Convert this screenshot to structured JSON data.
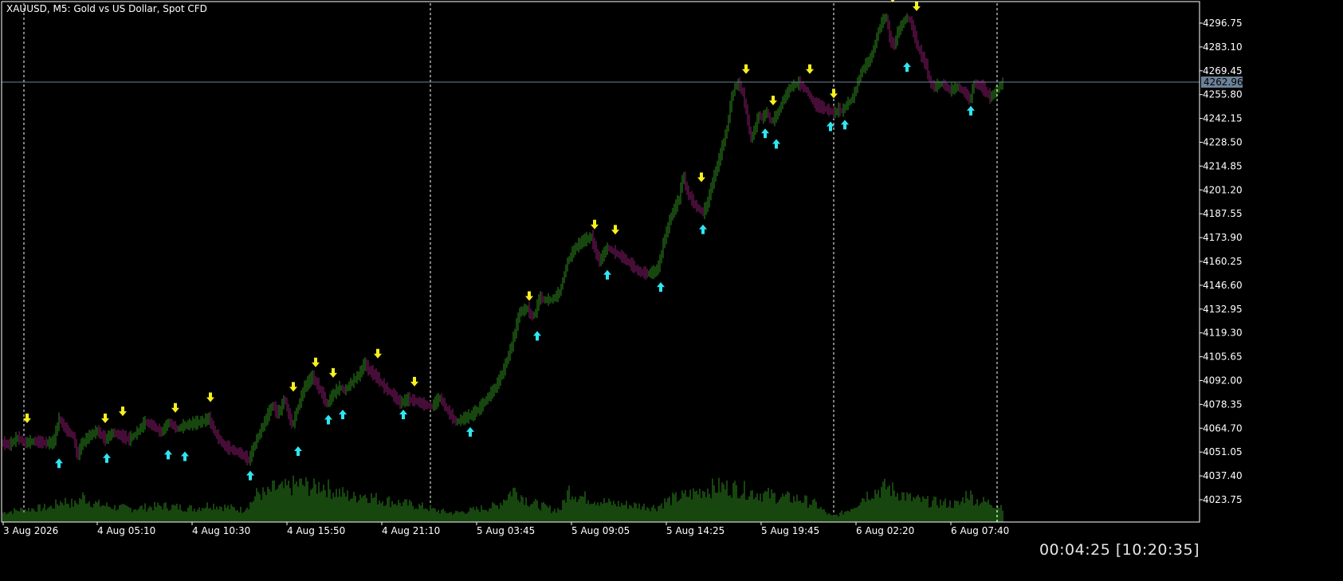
{
  "title": "XAUUSD, M5:  Gold vs US Dollar, Spot CFD",
  "timer": "00:04:25 [10:20:35]",
  "colors": {
    "background": "#000000",
    "bull": "#2e8b1e",
    "bear": "#8b1a6e",
    "volume": "#2e8b1e",
    "up_arrow": "#2fe6f0",
    "down_arrow": "#f5f01e",
    "price_line": "#6c8299",
    "price_label_bg": "#6c8299",
    "grid_separator": "#ffffff",
    "axis": "#ffffff"
  },
  "chart_data": {
    "type": "line",
    "symbol": "XAUUSD",
    "timeframe": "M5",
    "y_ticks": [
      "4296.75",
      "4283.10",
      "4269.45",
      "4255.80",
      "4242.15",
      "4228.50",
      "4214.85",
      "4201.20",
      "4187.55",
      "4173.90",
      "4160.25",
      "4146.60",
      "4132.95",
      "4119.30",
      "4105.65",
      "4092.00",
      "4078.35",
      "4064.70",
      "4051.05",
      "4037.40",
      "4023.75"
    ],
    "x_ticks": [
      "3 Aug 2026",
      "4 Aug 05:10",
      "4 Aug 10:30",
      "4 Aug 15:50",
      "4 Aug 21:10",
      "5 Aug 03:45",
      "5 Aug 09:05",
      "5 Aug 14:25",
      "5 Aug 19:45",
      "6 Aug 02:20",
      "6 Aug 07:40"
    ],
    "ylim": [
      4016,
      4307
    ],
    "current_price": "4262.96",
    "day_separators_index": [
      13,
      267,
      521
    ],
    "price_path": [
      [
        0,
        4056
      ],
      [
        10,
        4055
      ],
      [
        20,
        4059
      ],
      [
        30,
        4056
      ],
      [
        40,
        4057
      ],
      [
        55,
        4056
      ],
      [
        65,
        4056
      ],
      [
        72,
        4070
      ],
      [
        80,
        4064
      ],
      [
        90,
        4060
      ],
      [
        95,
        4048
      ],
      [
        100,
        4055
      ],
      [
        110,
        4060
      ],
      [
        120,
        4063
      ],
      [
        130,
        4058
      ],
      [
        140,
        4062
      ],
      [
        150,
        4060
      ],
      [
        160,
        4058
      ],
      [
        170,
        4062
      ],
      [
        180,
        4068
      ],
      [
        190,
        4066
      ],
      [
        200,
        4062
      ],
      [
        210,
        4068
      ],
      [
        220,
        4064
      ],
      [
        230,
        4066
      ],
      [
        240,
        4067
      ],
      [
        250,
        4068
      ],
      [
        260,
        4070
      ],
      [
        270,
        4060
      ],
      [
        280,
        4054
      ],
      [
        290,
        4052
      ],
      [
        300,
        4050
      ],
      [
        310,
        4046
      ],
      [
        320,
        4058
      ],
      [
        330,
        4068
      ],
      [
        340,
        4078
      ],
      [
        345,
        4073
      ],
      [
        350,
        4075
      ],
      [
        355,
        4082
      ],
      [
        360,
        4072
      ],
      [
        365,
        4066
      ],
      [
        370,
        4074
      ],
      [
        380,
        4088
      ],
      [
        390,
        4094
      ],
      [
        400,
        4086
      ],
      [
        408,
        4078
      ],
      [
        416,
        4084
      ],
      [
        425,
        4088
      ],
      [
        430,
        4086
      ],
      [
        440,
        4091
      ],
      [
        450,
        4096
      ],
      [
        455,
        4102
      ],
      [
        460,
        4098
      ],
      [
        470,
        4094
      ],
      [
        480,
        4088
      ],
      [
        490,
        4084
      ],
      [
        500,
        4079
      ],
      [
        510,
        4081
      ],
      [
        520,
        4080
      ],
      [
        530,
        4078
      ],
      [
        540,
        4077
      ],
      [
        550,
        4082
      ],
      [
        555,
        4078
      ],
      [
        560,
        4074
      ],
      [
        570,
        4068
      ],
      [
        580,
        4070
      ],
      [
        590,
        4072
      ],
      [
        600,
        4076
      ],
      [
        610,
        4082
      ],
      [
        620,
        4088
      ],
      [
        630,
        4098
      ],
      [
        640,
        4112
      ],
      [
        650,
        4131
      ],
      [
        660,
        4133
      ],
      [
        665,
        4128
      ],
      [
        670,
        4131
      ],
      [
        675,
        4140
      ],
      [
        680,
        4138
      ],
      [
        690,
        4138
      ],
      [
        700,
        4142
      ],
      [
        710,
        4160
      ],
      [
        720,
        4168
      ],
      [
        730,
        4172
      ],
      [
        740,
        4174
      ],
      [
        745,
        4166
      ],
      [
        750,
        4160
      ],
      [
        760,
        4168
      ],
      [
        770,
        4165
      ],
      [
        780,
        4162
      ],
      [
        790,
        4158
      ],
      [
        800,
        4154
      ],
      [
        810,
        4153
      ],
      [
        820,
        4154
      ],
      [
        825,
        4158
      ],
      [
        830,
        4170
      ],
      [
        840,
        4186
      ],
      [
        850,
        4196
      ],
      [
        855,
        4210
      ],
      [
        860,
        4200
      ],
      [
        865,
        4196
      ],
      [
        870,
        4192
      ],
      [
        875,
        4190
      ],
      [
        880,
        4188
      ],
      [
        885,
        4192
      ],
      [
        890,
        4202
      ],
      [
        900,
        4218
      ],
      [
        910,
        4236
      ],
      [
        915,
        4252
      ],
      [
        920,
        4260
      ],
      [
        925,
        4262
      ],
      [
        930,
        4256
      ],
      [
        935,
        4244
      ],
      [
        940,
        4230
      ],
      [
        945,
        4236
      ],
      [
        950,
        4244
      ],
      [
        955,
        4242
      ],
      [
        960,
        4246
      ],
      [
        965,
        4240
      ],
      [
        970,
        4242
      ],
      [
        975,
        4246
      ],
      [
        980,
        4252
      ],
      [
        990,
        4260
      ],
      [
        1000,
        4262
      ],
      [
        1010,
        4258
      ],
      [
        1020,
        4250
      ],
      [
        1030,
        4248
      ],
      [
        1040,
        4246
      ],
      [
        1045,
        4245
      ],
      [
        1050,
        4247
      ],
      [
        1055,
        4246
      ],
      [
        1060,
        4250
      ],
      [
        1065,
        4252
      ],
      [
        1070,
        4256
      ],
      [
        1075,
        4264
      ],
      [
        1080,
        4270
      ],
      [
        1090,
        4276
      ],
      [
        1095,
        4283
      ],
      [
        1100,
        4292
      ],
      [
        1105,
        4298
      ],
      [
        1110,
        4300
      ],
      [
        1115,
        4286
      ],
      [
        1120,
        4284
      ],
      [
        1125,
        4292
      ],
      [
        1130,
        4296
      ],
      [
        1135,
        4300
      ],
      [
        1140,
        4298
      ],
      [
        1145,
        4290
      ],
      [
        1150,
        4282
      ],
      [
        1160,
        4272
      ],
      [
        1165,
        4262
      ],
      [
        1170,
        4260
      ],
      [
        1180,
        4262
      ],
      [
        1190,
        4258
      ],
      [
        1200,
        4260
      ],
      [
        1210,
        4256
      ],
      [
        1215,
        4252
      ],
      [
        1220,
        4262
      ],
      [
        1230,
        4260
      ],
      [
        1240,
        4254
      ],
      [
        1245,
        4256
      ],
      [
        1255,
        4262
      ]
    ],
    "signals_down": [
      [
        30,
        4064
      ],
      [
        128,
        4064
      ],
      [
        150,
        4068
      ],
      [
        216,
        4070
      ],
      [
        260,
        4076
      ],
      [
        364,
        4082
      ],
      [
        392,
        4096
      ],
      [
        414,
        4090
      ],
      [
        470,
        4101
      ],
      [
        516,
        4085
      ],
      [
        660,
        4134
      ],
      [
        742,
        4175
      ],
      [
        768,
        4172
      ],
      [
        876,
        4202
      ],
      [
        932,
        4264
      ],
      [
        966,
        4246
      ],
      [
        1012,
        4264
      ],
      [
        1042,
        4250
      ],
      [
        1116,
        4305
      ],
      [
        1146,
        4300
      ]
    ],
    "signals_up": [
      [
        70,
        4051
      ],
      [
        130,
        4054
      ],
      [
        207,
        4056
      ],
      [
        228,
        4055
      ],
      [
        310,
        4044
      ],
      [
        370,
        4058
      ],
      [
        408,
        4076
      ],
      [
        426,
        4079
      ],
      [
        502,
        4079
      ],
      [
        586,
        4069
      ],
      [
        670,
        4124
      ],
      [
        758,
        4159
      ],
      [
        825,
        4152
      ],
      [
        878,
        4185
      ],
      [
        956,
        4240
      ],
      [
        970,
        4234
      ],
      [
        1038,
        4244
      ],
      [
        1056,
        4245
      ],
      [
        1134,
        4278
      ],
      [
        1214,
        4253
      ]
    ],
    "volume_envelope": [
      [
        0,
        14
      ],
      [
        20,
        18
      ],
      [
        40,
        20
      ],
      [
        60,
        22
      ],
      [
        75,
        32
      ],
      [
        90,
        26
      ],
      [
        100,
        38
      ],
      [
        110,
        30
      ],
      [
        120,
        26
      ],
      [
        140,
        22
      ],
      [
        160,
        20
      ],
      [
        180,
        22
      ],
      [
        200,
        24
      ],
      [
        220,
        22
      ],
      [
        240,
        20
      ],
      [
        260,
        26
      ],
      [
        280,
        22
      ],
      [
        300,
        18
      ],
      [
        312,
        30
      ],
      [
        320,
        44
      ],
      [
        330,
        40
      ],
      [
        340,
        50
      ],
      [
        350,
        48
      ],
      [
        360,
        52
      ],
      [
        370,
        56
      ],
      [
        380,
        54
      ],
      [
        390,
        50
      ],
      [
        400,
        56
      ],
      [
        410,
        48
      ],
      [
        420,
        44
      ],
      [
        430,
        40
      ],
      [
        440,
        36
      ],
      [
        450,
        42
      ],
      [
        460,
        38
      ],
      [
        470,
        34
      ],
      [
        480,
        32
      ],
      [
        490,
        30
      ],
      [
        500,
        28
      ],
      [
        510,
        26
      ],
      [
        520,
        24
      ],
      [
        530,
        22
      ],
      [
        540,
        18
      ],
      [
        550,
        16
      ],
      [
        560,
        14
      ],
      [
        570,
        14
      ],
      [
        580,
        16
      ],
      [
        590,
        18
      ],
      [
        600,
        20
      ],
      [
        620,
        24
      ],
      [
        640,
        48
      ],
      [
        650,
        40
      ],
      [
        660,
        30
      ],
      [
        670,
        26
      ],
      [
        680,
        22
      ],
      [
        690,
        18
      ],
      [
        700,
        20
      ],
      [
        710,
        48
      ],
      [
        720,
        40
      ],
      [
        730,
        36
      ],
      [
        740,
        34
      ],
      [
        760,
        28
      ],
      [
        780,
        26
      ],
      [
        800,
        24
      ],
      [
        820,
        22
      ],
      [
        830,
        30
      ],
      [
        840,
        34
      ],
      [
        860,
        40
      ],
      [
        880,
        48
      ],
      [
        900,
        52
      ],
      [
        920,
        50
      ],
      [
        940,
        44
      ],
      [
        960,
        40
      ],
      [
        980,
        36
      ],
      [
        1000,
        34
      ],
      [
        1020,
        26
      ],
      [
        1030,
        16
      ],
      [
        1040,
        8
      ],
      [
        1050,
        12
      ],
      [
        1060,
        18
      ],
      [
        1070,
        26
      ],
      [
        1080,
        38
      ],
      [
        1090,
        44
      ],
      [
        1100,
        48
      ],
      [
        1110,
        52
      ],
      [
        1120,
        44
      ],
      [
        1130,
        40
      ],
      [
        1140,
        34
      ],
      [
        1160,
        30
      ],
      [
        1180,
        28
      ],
      [
        1200,
        26
      ],
      [
        1210,
        44
      ],
      [
        1220,
        32
      ],
      [
        1240,
        28
      ],
      [
        1250,
        24
      ]
    ]
  }
}
